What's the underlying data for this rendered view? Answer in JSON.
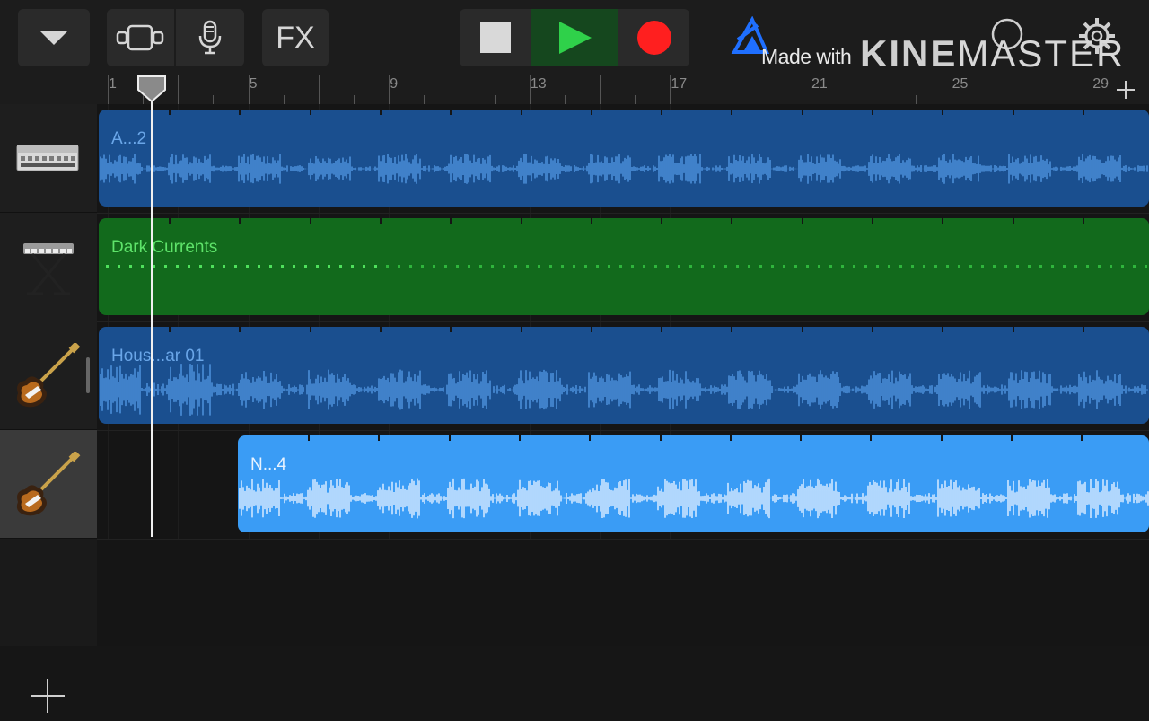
{
  "toolbar": {
    "fx_label": "FX",
    "icons": {
      "menu": "chevron-down-icon",
      "tracks_view": "tracks-view-icon",
      "mic": "microphone-icon",
      "stop": "stop-icon",
      "play": "play-icon",
      "record": "record-icon",
      "loop": "loop-browser-icon",
      "settings": "gear-icon"
    },
    "colors": {
      "play_active_bg": "#15471e",
      "play_icon": "#2fd14a",
      "record": "#ff1f1f"
    }
  },
  "watermark": {
    "made_with": "Made with",
    "brand_kine": "KINE",
    "brand_master": "MASTER"
  },
  "ruler": {
    "bar_labels": [
      "1",
      "5",
      "9",
      "13",
      "17",
      "21",
      "25",
      "29"
    ]
  },
  "tracks": [
    {
      "instrument": "drum-machine-icon",
      "selected": false
    },
    {
      "instrument": "keyboard-icon",
      "selected": false
    },
    {
      "instrument": "electric-guitar-icon",
      "selected": false
    },
    {
      "instrument": "electric-guitar-icon",
      "selected": true
    }
  ],
  "regions": [
    {
      "title": "A...2",
      "color": "#1a4f8f",
      "title_color": "#6aa6e8"
    },
    {
      "title": "Dark Currents",
      "color": "#126a1c",
      "title_color": "#5ee36a"
    },
    {
      "title": "Hous...ar 01",
      "color": "#1a4f8f",
      "title_color": "#6aa6e8"
    },
    {
      "title": "N...4",
      "color": "#3a9cf5",
      "title_color": "#e8f3ff"
    }
  ],
  "add_track_icon": "plus-icon"
}
